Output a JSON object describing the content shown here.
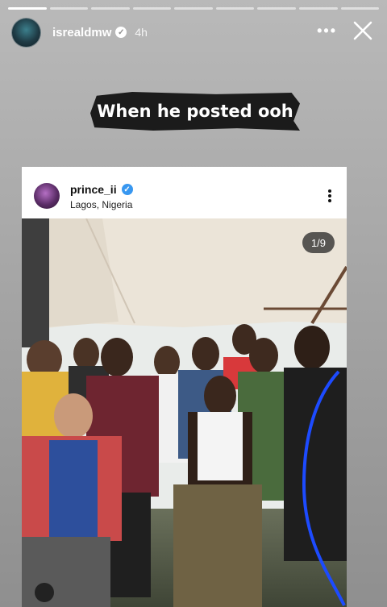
{
  "story": {
    "username": "isrealdmw",
    "time": "4h",
    "more_label": "•••",
    "progress_segments": 9,
    "progress_done": 1,
    "caption": "When he posted ooh"
  },
  "post": {
    "username": "prince_ii",
    "location": "Lagos, Nigeria",
    "counter": "1/9"
  },
  "colors": {
    "background": "#a6a6a6",
    "caption_bg": "#1b1b1b",
    "verified_blue": "#3897f0",
    "highlight_line": "#1d4bff"
  },
  "icons": [
    "verified-badge-icon",
    "more-icon",
    "close-icon",
    "post-more-icon",
    "reel-icon"
  ]
}
